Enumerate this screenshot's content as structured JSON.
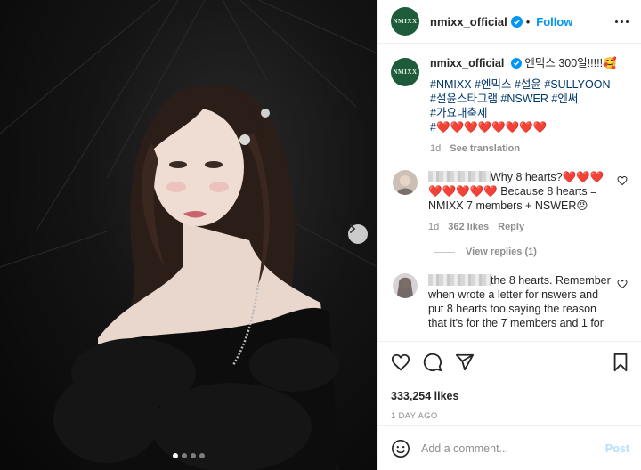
{
  "account": {
    "logo_text": "NMIXX",
    "username": "nmixx_official",
    "follow_label": "Follow",
    "separator": "•"
  },
  "caption": {
    "username": "nmixx_official",
    "text": "엔믹스 300일!!!!!🥰",
    "hashtags_line1": "#NMIXX #엔믹스 #설윤 #SULLYOON",
    "hashtags_line2": "#설윤스타그램 #NSWER #엔써",
    "hashtags_line3": "#가요대축제",
    "hearts_line": "#❤️❤️❤️❤️❤️❤️❤️❤️",
    "time": "1d",
    "see_translation": "See translation"
  },
  "comments": [
    {
      "text_a": "Why 8 hearts?❤️❤️❤️",
      "text_b": "❤️❤️❤️❤️❤️ Because 8 hearts =",
      "text_c": "NMIXX 7 members + NSWER😠",
      "time": "1d",
      "likes": "362 likes",
      "reply": "Reply",
      "view_replies": "View replies (1)"
    },
    {
      "text_a": "the 8 hearts. Remember",
      "text_b": "when wrote a letter for nswers and",
      "text_c": "put 8 hearts too saying the reason",
      "text_d": "that it's for the 7 members and 1 for"
    }
  ],
  "post": {
    "likes": "333,254 likes",
    "ago": "1 DAY AGO"
  },
  "comment_box": {
    "placeholder": "Add a comment...",
    "post_label": "Post"
  },
  "carousel": {
    "slides": 4,
    "active": 0
  },
  "colors": {
    "accent": "#0095f6",
    "avatar_bg": "#1e5b3a",
    "heart": "#e0204a"
  }
}
